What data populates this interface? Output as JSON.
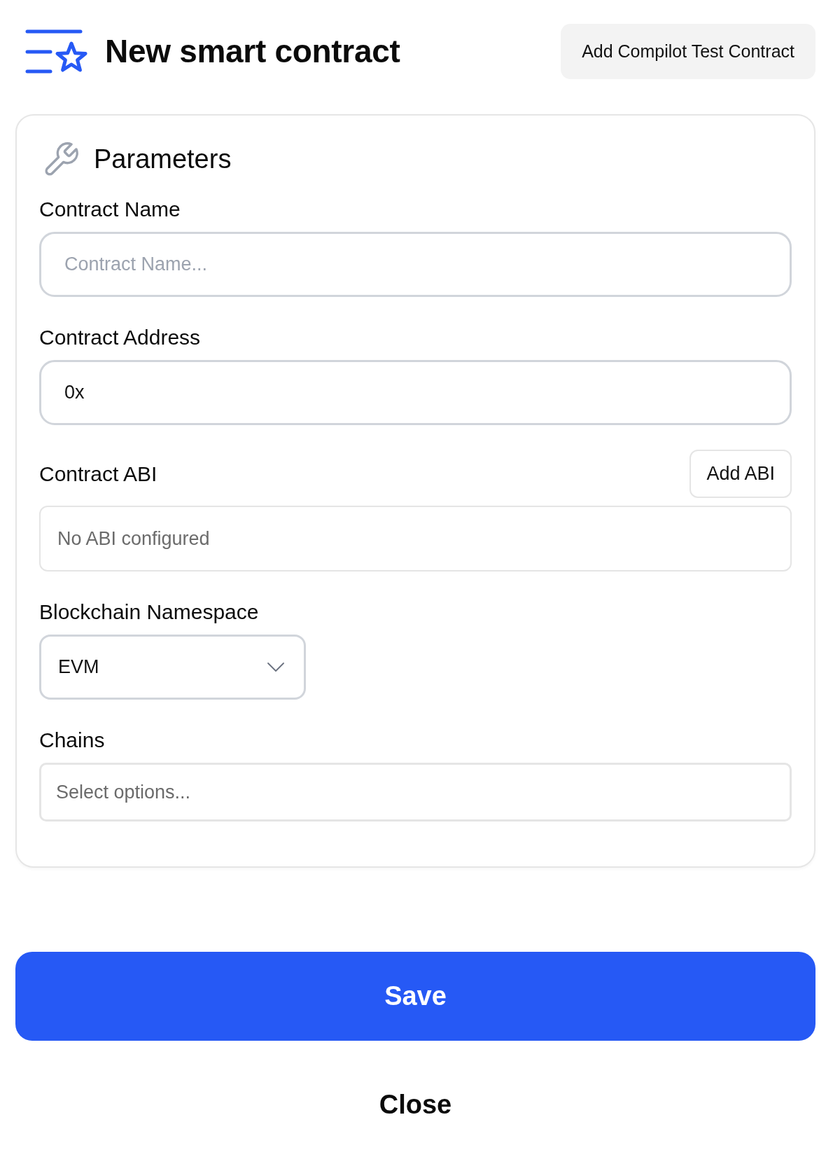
{
  "header": {
    "title": "New smart contract",
    "action_button": "Add Compilot Test Contract"
  },
  "section": {
    "title": "Parameters"
  },
  "fields": [
    {
      "kind": "text",
      "label": "Contract Name",
      "placeholder": "Contract Name..."
    },
    {
      "kind": "text",
      "label": "Contract Address",
      "value": "0x"
    },
    {
      "kind": "abi",
      "label": "Contract ABI",
      "button": "Add ABI",
      "value": "No ABI configured"
    },
    {
      "kind": "select",
      "label": "Blockchain Namespace",
      "value": "EVM"
    },
    {
      "kind": "multiselect",
      "label": "Chains",
      "placeholder": "Select options..."
    }
  ],
  "buttons": [
    {
      "kind": "primary",
      "label": "Save"
    },
    {
      "kind": "text",
      "label": "Close"
    }
  ]
}
